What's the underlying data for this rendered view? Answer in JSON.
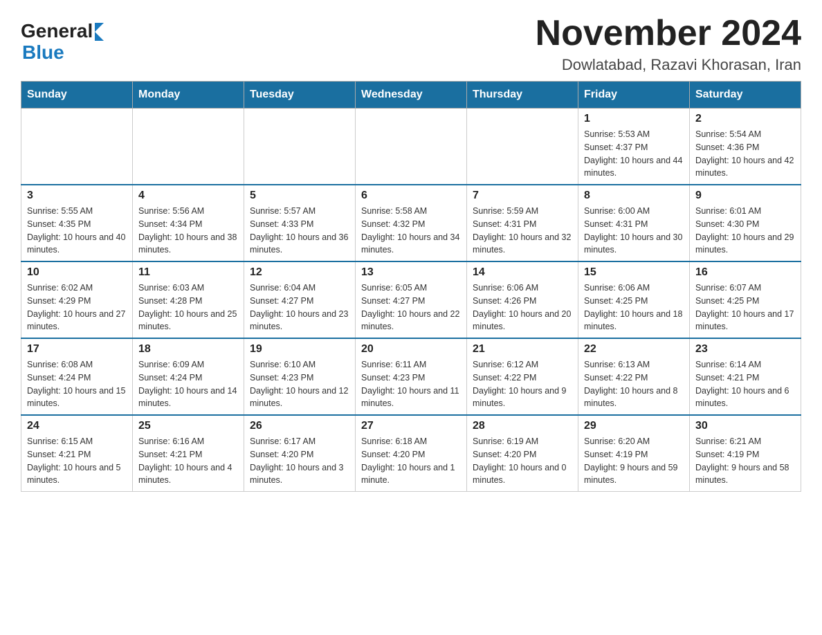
{
  "header": {
    "logo_general": "General",
    "logo_blue": "Blue",
    "title": "November 2024",
    "location": "Dowlatabad, Razavi Khorasan, Iran"
  },
  "weekdays": [
    "Sunday",
    "Monday",
    "Tuesday",
    "Wednesday",
    "Thursday",
    "Friday",
    "Saturday"
  ],
  "weeks": [
    [
      {
        "day": "",
        "info": ""
      },
      {
        "day": "",
        "info": ""
      },
      {
        "day": "",
        "info": ""
      },
      {
        "day": "",
        "info": ""
      },
      {
        "day": "",
        "info": ""
      },
      {
        "day": "1",
        "info": "Sunrise: 5:53 AM\nSunset: 4:37 PM\nDaylight: 10 hours and 44 minutes."
      },
      {
        "day": "2",
        "info": "Sunrise: 5:54 AM\nSunset: 4:36 PM\nDaylight: 10 hours and 42 minutes."
      }
    ],
    [
      {
        "day": "3",
        "info": "Sunrise: 5:55 AM\nSunset: 4:35 PM\nDaylight: 10 hours and 40 minutes."
      },
      {
        "day": "4",
        "info": "Sunrise: 5:56 AM\nSunset: 4:34 PM\nDaylight: 10 hours and 38 minutes."
      },
      {
        "day": "5",
        "info": "Sunrise: 5:57 AM\nSunset: 4:33 PM\nDaylight: 10 hours and 36 minutes."
      },
      {
        "day": "6",
        "info": "Sunrise: 5:58 AM\nSunset: 4:32 PM\nDaylight: 10 hours and 34 minutes."
      },
      {
        "day": "7",
        "info": "Sunrise: 5:59 AM\nSunset: 4:31 PM\nDaylight: 10 hours and 32 minutes."
      },
      {
        "day": "8",
        "info": "Sunrise: 6:00 AM\nSunset: 4:31 PM\nDaylight: 10 hours and 30 minutes."
      },
      {
        "day": "9",
        "info": "Sunrise: 6:01 AM\nSunset: 4:30 PM\nDaylight: 10 hours and 29 minutes."
      }
    ],
    [
      {
        "day": "10",
        "info": "Sunrise: 6:02 AM\nSunset: 4:29 PM\nDaylight: 10 hours and 27 minutes."
      },
      {
        "day": "11",
        "info": "Sunrise: 6:03 AM\nSunset: 4:28 PM\nDaylight: 10 hours and 25 minutes."
      },
      {
        "day": "12",
        "info": "Sunrise: 6:04 AM\nSunset: 4:27 PM\nDaylight: 10 hours and 23 minutes."
      },
      {
        "day": "13",
        "info": "Sunrise: 6:05 AM\nSunset: 4:27 PM\nDaylight: 10 hours and 22 minutes."
      },
      {
        "day": "14",
        "info": "Sunrise: 6:06 AM\nSunset: 4:26 PM\nDaylight: 10 hours and 20 minutes."
      },
      {
        "day": "15",
        "info": "Sunrise: 6:06 AM\nSunset: 4:25 PM\nDaylight: 10 hours and 18 minutes."
      },
      {
        "day": "16",
        "info": "Sunrise: 6:07 AM\nSunset: 4:25 PM\nDaylight: 10 hours and 17 minutes."
      }
    ],
    [
      {
        "day": "17",
        "info": "Sunrise: 6:08 AM\nSunset: 4:24 PM\nDaylight: 10 hours and 15 minutes."
      },
      {
        "day": "18",
        "info": "Sunrise: 6:09 AM\nSunset: 4:24 PM\nDaylight: 10 hours and 14 minutes."
      },
      {
        "day": "19",
        "info": "Sunrise: 6:10 AM\nSunset: 4:23 PM\nDaylight: 10 hours and 12 minutes."
      },
      {
        "day": "20",
        "info": "Sunrise: 6:11 AM\nSunset: 4:23 PM\nDaylight: 10 hours and 11 minutes."
      },
      {
        "day": "21",
        "info": "Sunrise: 6:12 AM\nSunset: 4:22 PM\nDaylight: 10 hours and 9 minutes."
      },
      {
        "day": "22",
        "info": "Sunrise: 6:13 AM\nSunset: 4:22 PM\nDaylight: 10 hours and 8 minutes."
      },
      {
        "day": "23",
        "info": "Sunrise: 6:14 AM\nSunset: 4:21 PM\nDaylight: 10 hours and 6 minutes."
      }
    ],
    [
      {
        "day": "24",
        "info": "Sunrise: 6:15 AM\nSunset: 4:21 PM\nDaylight: 10 hours and 5 minutes."
      },
      {
        "day": "25",
        "info": "Sunrise: 6:16 AM\nSunset: 4:21 PM\nDaylight: 10 hours and 4 minutes."
      },
      {
        "day": "26",
        "info": "Sunrise: 6:17 AM\nSunset: 4:20 PM\nDaylight: 10 hours and 3 minutes."
      },
      {
        "day": "27",
        "info": "Sunrise: 6:18 AM\nSunset: 4:20 PM\nDaylight: 10 hours and 1 minute."
      },
      {
        "day": "28",
        "info": "Sunrise: 6:19 AM\nSunset: 4:20 PM\nDaylight: 10 hours and 0 minutes."
      },
      {
        "day": "29",
        "info": "Sunrise: 6:20 AM\nSunset: 4:19 PM\nDaylight: 9 hours and 59 minutes."
      },
      {
        "day": "30",
        "info": "Sunrise: 6:21 AM\nSunset: 4:19 PM\nDaylight: 9 hours and 58 minutes."
      }
    ]
  ]
}
